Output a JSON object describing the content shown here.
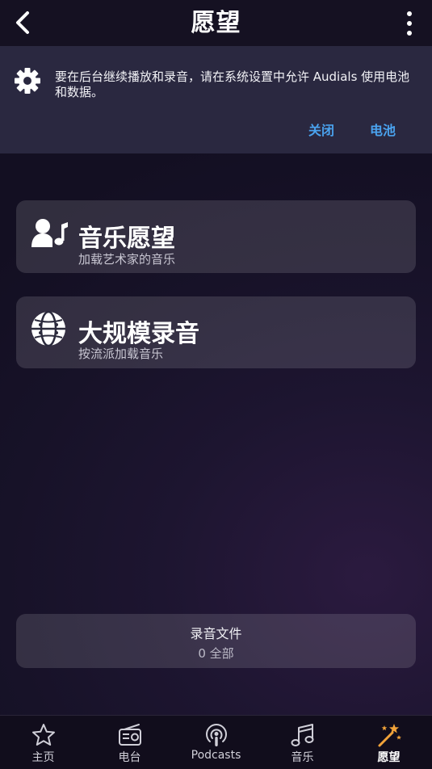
{
  "header": {
    "title": "愿望"
  },
  "notice": {
    "text": "要在后台继续播放和录音，请在系统设置中允许 Audials 使用电池和数据。",
    "close_label": "关闭",
    "battery_label": "电池"
  },
  "cards": [
    {
      "title": "音乐愿望",
      "subtitle": "加载艺术家的音乐",
      "icon": "artist-music-icon"
    },
    {
      "title": "大规模录音",
      "subtitle": "按流派加载音乐",
      "icon": "globe-genres-icon"
    }
  ],
  "recordings": {
    "title": "录音文件",
    "count": "0 全部"
  },
  "nav": {
    "items": [
      {
        "label": "主页",
        "icon": "star-icon",
        "active": false
      },
      {
        "label": "电台",
        "icon": "radio-icon",
        "active": false
      },
      {
        "label": "Podcasts",
        "icon": "podcast-icon",
        "active": false
      },
      {
        "label": "音乐",
        "icon": "music-note-icon",
        "active": false
      },
      {
        "label": "愿望",
        "icon": "magic-wand-icon",
        "active": true
      }
    ]
  },
  "colors": {
    "accent": "#4aa3ef",
    "wand_star": "#f2a33a"
  }
}
